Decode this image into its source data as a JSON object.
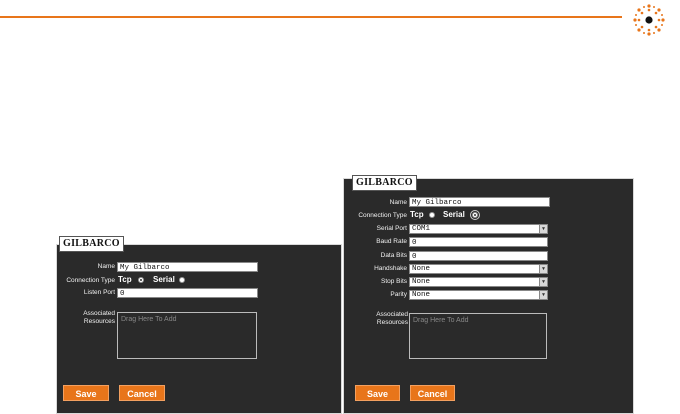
{
  "colors": {
    "accent": "#e8751a",
    "panel": "#2a2a2a"
  },
  "logo": {
    "icon": "sun-burst-logo-icon"
  },
  "forms": [
    {
      "brand": "GILBARCO",
      "name_label": "Name",
      "name_value": "My Gilbarco",
      "connection_label": "Connection Type",
      "tcp_label": "Tcp",
      "serial_label": "Serial",
      "port_label": "Listen Port",
      "port_value": "0",
      "resources_label": "Associated Resources",
      "drop_placeholder": "Drag Here To Add",
      "save_label": "Save",
      "cancel_label": "Cancel"
    },
    {
      "brand": "GILBARCO",
      "name_label": "Name",
      "name_value": "My Gilbarco",
      "connection_label": "Connection Type",
      "tcp_label": "Tcp",
      "serial_label": "Serial",
      "serial_port_label": "Serial Port",
      "serial_port_value": "COM1",
      "baud_label": "Baud Rate",
      "baud_value": "0",
      "data_bits_label": "Data Bits",
      "data_bits_value": "0",
      "handshake_label": "Handshake",
      "handshake_value": "None",
      "stop_bits_label": "Stop Bits",
      "stop_bits_value": "None",
      "parity_label": "Parity",
      "parity_value": "None",
      "resources_label": "Associated Resources",
      "drop_placeholder": "Drag Here To Add",
      "save_label": "Save",
      "cancel_label": "Cancel"
    }
  ]
}
